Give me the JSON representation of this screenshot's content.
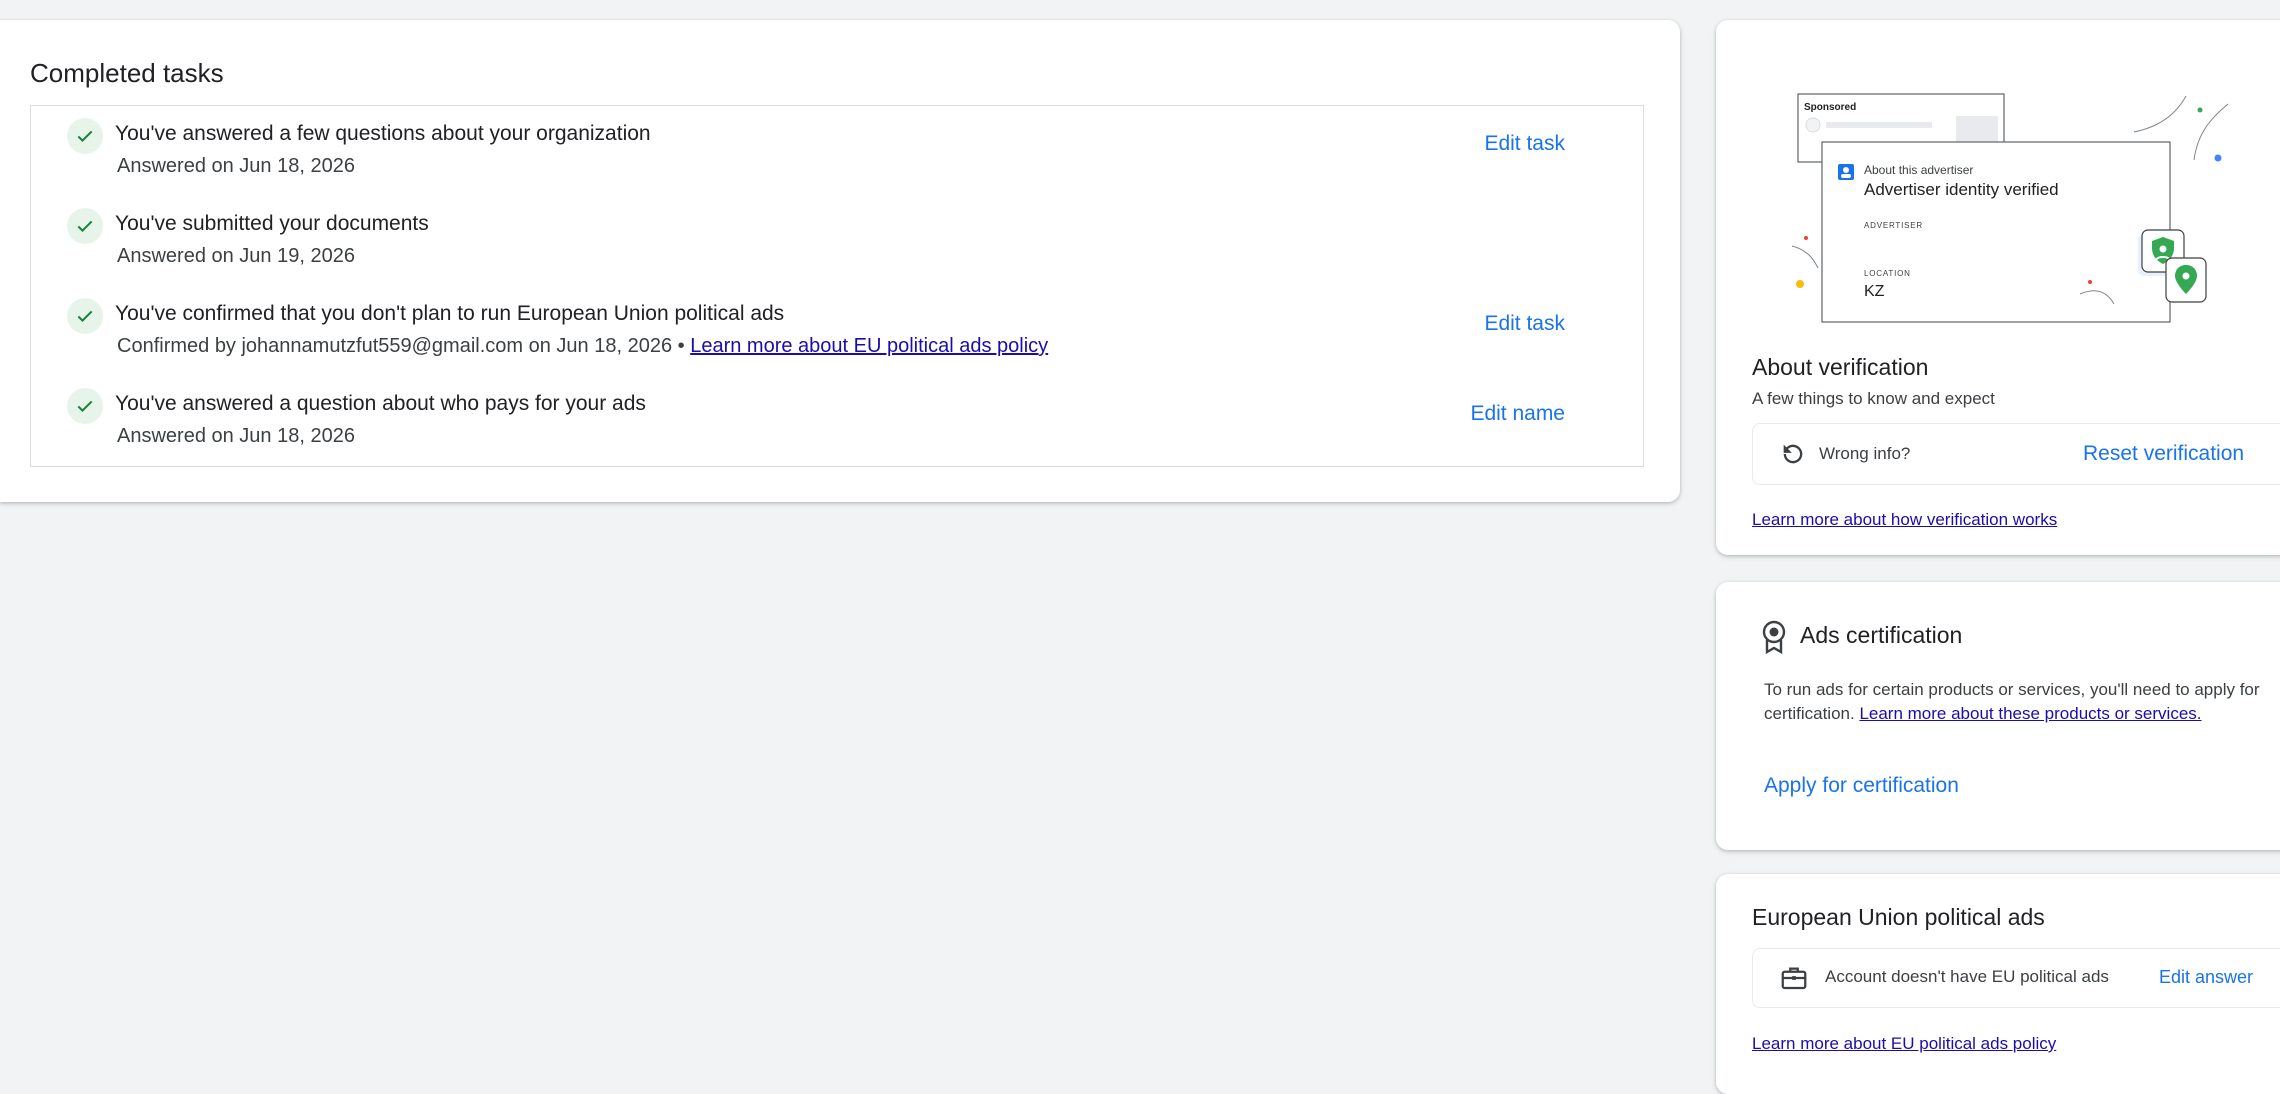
{
  "completed": {
    "title": "Completed tasks",
    "tasks": [
      {
        "title": "You've answered a few questions about your organization",
        "subtitle": "Answered on Jun 18, 2026",
        "action": "Edit task"
      },
      {
        "title": "You've submitted your documents",
        "subtitle": "Answered on Jun 19, 2026",
        "action": ""
      },
      {
        "title": "You've confirmed that you don't plan to run European Union political ads",
        "subtitle": "Confirmed by johannamutzfut559@gmail.com on Jun 18, 2026 •",
        "link": "Learn more about EU political ads policy",
        "action": "Edit task"
      },
      {
        "title": "You've answered a question about who pays for your ads",
        "subtitle": "Answered on Jun 18, 2026",
        "action": "Edit name"
      }
    ]
  },
  "illustration": {
    "sponsored": "Sponsored",
    "about_advertiser": "About this advertiser",
    "verified": "Advertiser identity verified",
    "advertiser_label": "ADVERTISER",
    "location_label": "LOCATION",
    "location_value": "KZ"
  },
  "verification": {
    "title": "About verification",
    "subtitle": "A few things to know and expect",
    "wrong_info": "Wrong info?",
    "reset": "Reset verification",
    "learn_more": "Learn more about how verification works"
  },
  "certification": {
    "title": "Ads certification",
    "body": "To run ads for certain products or services, you'll need to apply for certification.",
    "link": "Learn more about these products or services.",
    "apply": "Apply for certification"
  },
  "eu_ads": {
    "title": "European Union political ads",
    "status": "Account doesn't have EU political ads",
    "edit": "Edit answer",
    "learn_more": "Learn more about EU political ads policy"
  },
  "colors": {
    "accent": "#1a73e8",
    "check_bg": "#e6f4ea",
    "check": "#188038",
    "link": "#1a0dab"
  }
}
